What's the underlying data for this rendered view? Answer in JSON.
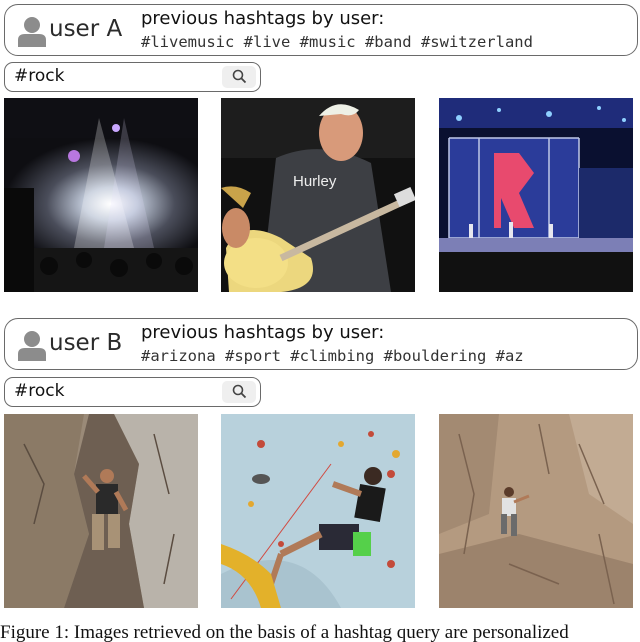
{
  "users": [
    {
      "name": "user A",
      "history_title": "previous hashtags by user:",
      "history_tags": "#livemusic #live #music #band #switzerland",
      "search_query": "#rock",
      "icon": "search-icon"
    },
    {
      "name": "user B",
      "history_title": "previous hashtags by user:",
      "history_tags": "#arizona #sport #climbing #bouldering #az",
      "search_query": "#rock",
      "icon": "search-icon"
    }
  ],
  "caption": "Figure 1: Images retrieved on the basis of a hashtag query are personalized"
}
